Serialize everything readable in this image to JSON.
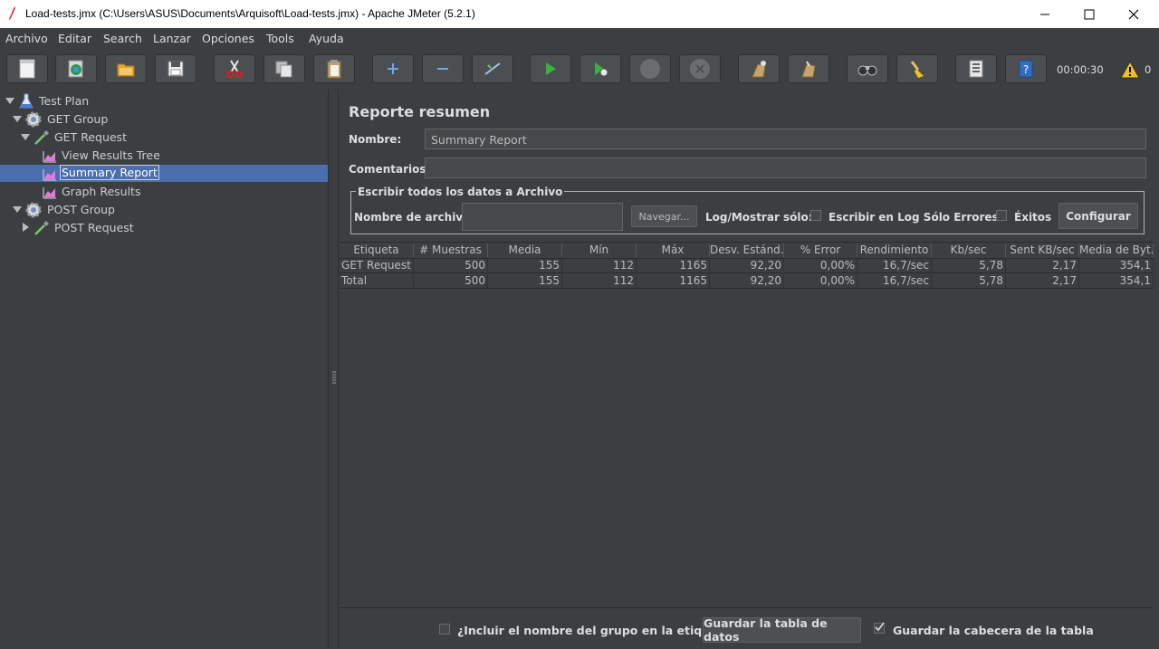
{
  "window": {
    "title": "Load-tests.jmx (C:\\Users\\ASUS\\Documents\\Arquisoft\\Load-tests.jmx) - Apache JMeter (5.2.1)"
  },
  "menu": [
    {
      "label": "Archivo"
    },
    {
      "label": "Editar"
    },
    {
      "label": "Search"
    },
    {
      "label": "Lanzar"
    },
    {
      "label": "Opciones"
    },
    {
      "label": "Tools"
    },
    {
      "label": "Ayuda"
    }
  ],
  "toolbar": {
    "timer": "00:00:30",
    "warning_count": "0"
  },
  "tree": [
    {
      "label": "Test Plan",
      "icon": "flask-icon"
    },
    {
      "label": "GET Group",
      "icon": "gear-icon"
    },
    {
      "label": "GET Request",
      "icon": "pipette-icon"
    },
    {
      "label": "View Results Tree",
      "icon": "chart-icon"
    },
    {
      "label": "Summary Report",
      "icon": "chart-icon",
      "selected": true
    },
    {
      "label": "Graph Results",
      "icon": "chart-icon"
    },
    {
      "label": "POST Group",
      "icon": "gear-icon"
    },
    {
      "label": "POST Request",
      "icon": "pipette-icon"
    }
  ],
  "panel": {
    "title": "Reporte resumen",
    "name_label": "Nombre:",
    "name_value": "Summary Report",
    "comments_label": "Comentarios",
    "comments_value": "",
    "file_group_title": "Escribir todos los datos a Archivo",
    "filename_label": "Nombre de archivo",
    "browse_label": "Navegar...",
    "log_label": "Log/Mostrar sólo:",
    "errors_label": "Escribir en Log Sólo Errores",
    "success_label": "Éxitos",
    "configure_label": "Configurar"
  },
  "table": {
    "headers": [
      "Etiqueta",
      "# Muestras",
      "Media",
      "Mín",
      "Máx",
      "Desv. Estánd.",
      "% Error",
      "Rendimiento",
      "Kb/sec",
      "Sent KB/sec",
      "Media de Byt..."
    ],
    "rows": [
      [
        "GET Request",
        "500",
        "155",
        "112",
        "1165",
        "92,20",
        "0,00%",
        "16,7/sec",
        "5,78",
        "2,17",
        "354,1"
      ],
      [
        "Total",
        "500",
        "155",
        "112",
        "1165",
        "92,20",
        "0,00%",
        "16,7/sec",
        "5,78",
        "2,17",
        "354,1"
      ]
    ]
  },
  "bottom": {
    "include_group_label": "¿Incluir el nombre del grupo en la etiqueta?",
    "save_table_label": "Guardar la tabla de datos",
    "save_header_label": "Guardar la cabecera de la tabla"
  },
  "colors": {
    "background": "#3c3f41",
    "selection": "#4b6eaf",
    "run_green": "#3ab03e"
  }
}
